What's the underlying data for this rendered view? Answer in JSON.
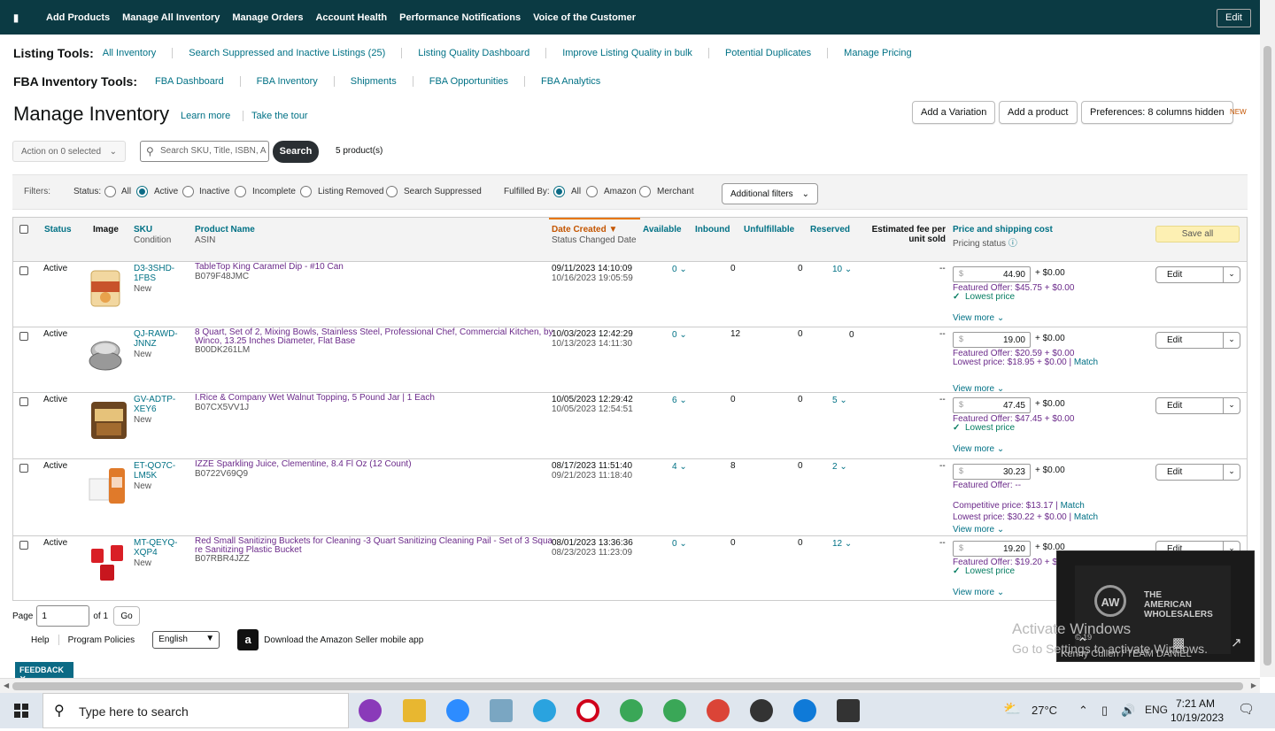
{
  "nav": {
    "items": [
      "Add Products",
      "Manage All Inventory",
      "Manage Orders",
      "Account Health",
      "Performance Notifications",
      "Voice of the Customer"
    ],
    "edit_label": "Edit"
  },
  "listing_tools": {
    "label": "Listing Tools:",
    "links": [
      "All Inventory",
      "Search Suppressed and Inactive Listings (25)",
      "Listing Quality Dashboard",
      "Improve Listing Quality in bulk",
      "Potential Duplicates",
      "Manage Pricing"
    ]
  },
  "fba_tools": {
    "label": "FBA Inventory Tools:",
    "links": [
      "FBA Dashboard",
      "FBA Inventory",
      "Shipments",
      "FBA Opportunities",
      "FBA Analytics"
    ]
  },
  "header": {
    "title": "Manage Inventory",
    "learn_more": "Learn more",
    "take_tour": "Take the tour",
    "add_variation": "Add a Variation",
    "add_product": "Add a product",
    "preferences": "Preferences: 8 columns hidden",
    "new_badge": "NEW"
  },
  "action_bar": {
    "action_select": "Action on 0 selected",
    "search_placeholder": "Search SKU, Title, ISBN, A",
    "search_button": "Search",
    "product_count": "5 product(s)"
  },
  "filters": {
    "label": "Filters:",
    "status_label": "Status:",
    "status_options": [
      "All",
      "Active",
      "Inactive",
      "Incomplete",
      "Listing Removed",
      "Search Suppressed"
    ],
    "status_selected": "Active",
    "fulfilled_label": "Fulfilled By:",
    "fulfilled_options": [
      "All",
      "Amazon",
      "Merchant"
    ],
    "fulfilled_selected": "All",
    "additional": "Additional filters"
  },
  "columns": {
    "status": "Status",
    "image": "Image",
    "sku": "SKU",
    "sku_sub": "Condition",
    "product": "Product Name",
    "product_sub": "ASIN",
    "date": "Date Created",
    "date_sub": "Status Changed Date",
    "available": "Available",
    "inbound": "Inbound",
    "unfulfillable": "Unfulfillable",
    "reserved": "Reserved",
    "fee_line1": "Estimated fee per",
    "fee_line2": "unit sold",
    "price": "Price and shipping cost",
    "price_sub": "Pricing status",
    "save_all": "Save all"
  },
  "rows": [
    {
      "status": "Active",
      "sku1": "D3-3SHD-",
      "sku2": "1FBS",
      "condition": "New",
      "name1": "TableTop King Caramel Dip - #10 Can",
      "name2": "",
      "asin": "B079F48JMC",
      "created": "09/11/2023 14:10:09",
      "changed": "10/16/2023 19:05:59",
      "available": "0",
      "inbound": "0",
      "unfulfillable": "0",
      "reserved": "10",
      "fee": "--",
      "price": "44.90",
      "shipping": "+ $0.00",
      "featured": "Featured Offer: $45.75 + $0.00",
      "line2": "Lowest price",
      "line3": "",
      "view_more": "View more",
      "edit": "Edit"
    },
    {
      "status": "Active",
      "sku1": "QJ-RAWD-",
      "sku2": "JNNZ",
      "condition": "New",
      "name1": "8 Quart, Set of 2, Mixing Bowls, Stainless Steel, Professional Chef, Commercial Kitchen, by",
      "name2": "Winco, 13.25 Inches Diameter, Flat Base",
      "asin": "B00DK261LM",
      "created": "10/03/2023 12:42:29",
      "changed": "10/13/2023 14:11:30",
      "available": "0",
      "inbound": "12",
      "unfulfillable": "0",
      "reserved": "0",
      "fee": "--",
      "price": "19.00",
      "shipping": "+ $0.00",
      "featured": "Featured Offer: $20.59 + $0.00",
      "line2": "Lowest price: $18.95 + $0.00",
      "line3": "",
      "match": "Match",
      "view_more": "View more",
      "edit": "Edit"
    },
    {
      "status": "Active",
      "sku1": "GV-ADTP-",
      "sku2": "XEY6",
      "condition": "New",
      "name1": "I.Rice & Company Wet Walnut Topping, 5 Pound Jar | 1 Each",
      "name2": "",
      "asin": "B07CX5VV1J",
      "created": "10/05/2023 12:29:42",
      "changed": "10/05/2023 12:54:51",
      "available": "6",
      "inbound": "0",
      "unfulfillable": "0",
      "reserved": "5",
      "fee": "--",
      "price": "47.45",
      "shipping": "+ $0.00",
      "featured": "Featured Offer: $47.45 + $0.00",
      "line2": "Lowest price",
      "line3": "",
      "view_more": "View more",
      "edit": "Edit"
    },
    {
      "status": "Active",
      "sku1": "ET-QO7C-",
      "sku2": "LM5K",
      "condition": "New",
      "name1": "IZZE Sparkling Juice, Clementine, 8.4 Fl Oz (12 Count)",
      "name2": "",
      "asin": "B0722V69Q9",
      "created": "08/17/2023 11:51:40",
      "changed": "09/21/2023 11:18:40",
      "available": "4",
      "inbound": "8",
      "unfulfillable": "0",
      "reserved": "2",
      "fee": "--",
      "price": "30.23",
      "shipping": "+ $0.00",
      "featured": "Featured Offer: --",
      "line2": "Competitive price: $13.17",
      "line3": "Lowest price: $30.22 + $0.00",
      "match": "Match",
      "view_more": "View more",
      "edit": "Edit"
    },
    {
      "status": "Active",
      "sku1": "MT-QEYQ-",
      "sku2": "XQP4",
      "condition": "New",
      "name1": "Red Small Sanitizing Buckets for Cleaning -3 Quart Sanitizing Cleaning Pail - Set of 3 Squa",
      "name2": "re Sanitizing Plastic Bucket",
      "asin": "B07RBR4JZZ",
      "created": "08/01/2023 13:36:36",
      "changed": "08/23/2023 11:23:09",
      "available": "0",
      "inbound": "0",
      "unfulfillable": "0",
      "reserved": "12",
      "fee": "--",
      "price": "19.20",
      "shipping": "+ $0.00",
      "featured": "Featured Offer: $19.20 + $0",
      "line2": "Lowest price",
      "line3": "",
      "view_more": "View more",
      "edit": "Edit"
    }
  ],
  "pager": {
    "label": "Page",
    "value": "1",
    "of": "of 1",
    "go": "Go"
  },
  "footer": {
    "help": "Help",
    "policies": "Program Policies",
    "language": "English",
    "app": "Download the Amazon Seller mobile app",
    "feedback": "FEEDBACK"
  },
  "video": {
    "brand_line1": "THE",
    "brand_line2": "AMERICAN",
    "brand_line3": "WHOLESALERS",
    "caption": "Kenny Cullen / TEAM DANIEL",
    "copyright": "© 19"
  },
  "watermark": {
    "line1": "Activate Windows",
    "line2": "Go to Settings to activate Windows."
  },
  "taskbar": {
    "search": "Type here to search",
    "temp": "27°C",
    "lang": "ENG",
    "time": "7:21 AM",
    "date": "10/19/2023"
  }
}
